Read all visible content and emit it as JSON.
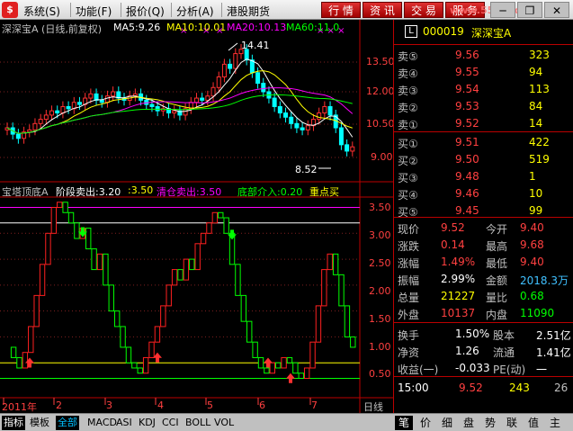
{
  "menubar": {
    "logo": "$",
    "items": [
      "系统(S)",
      "功能(F)",
      "报价(Q)",
      "分析(A)",
      "港股期货"
    ],
    "toolbar": [
      "行 情",
      "资 讯",
      "交 易",
      "服 务"
    ],
    "watermark": "www.55fx.com"
  },
  "kline": {
    "title": "深深宝A (日线,前复权)",
    "ma": [
      {
        "label": "MA5:9.26",
        "color": "#ffffff"
      },
      {
        "label": "MA10:10.01",
        "color": "#ffff00"
      },
      {
        "label": "MA20:10.13",
        "color": "#ff00ff"
      },
      {
        "label": "MA60:11.0",
        "color": "#00ff00"
      }
    ],
    "price_axis": [
      "13.50",
      "12.00",
      "10.50",
      "9.00"
    ],
    "high_mark": "14.41",
    "low_mark": "8.52"
  },
  "indicator": {
    "name": "宝塔顶底A",
    "lines": [
      {
        "text": "阶段卖出:3.20",
        "color": "#ffffff"
      },
      {
        "text": ":3.50",
        "color": "#ffff00"
      },
      {
        "text": "清仓卖出:3.50",
        "color": "#ff00ff"
      },
      {
        "text": "底部介入:0.20",
        "color": "#00ff00"
      },
      {
        "text": "重点买",
        "color": "#ffff00"
      }
    ],
    "axis": [
      "3.50",
      "3.00",
      "2.50",
      "2.00",
      "1.50",
      "1.00",
      "0.50"
    ]
  },
  "date_axis": [
    "2011年",
    "2",
    "3",
    "4",
    "5",
    "6",
    "7"
  ],
  "period_label": "日线",
  "bottom_tabs": [
    "指标",
    "模板",
    "全部",
    "MACD",
    "ASI",
    "KDJ",
    "CCI",
    "BOLL",
    "VOL"
  ],
  "right_tabs": [
    "笔",
    "价",
    "细",
    "盘",
    "势",
    "联",
    "值",
    "主"
  ],
  "quote": {
    "code": "000019",
    "name": "深深宝A",
    "sell": [
      {
        "label": "卖⑤",
        "price": "9.56",
        "vol": "323"
      },
      {
        "label": "卖④",
        "price": "9.55",
        "vol": "94"
      },
      {
        "label": "卖③",
        "price": "9.54",
        "vol": "113"
      },
      {
        "label": "卖②",
        "price": "9.53",
        "vol": "84"
      },
      {
        "label": "卖①",
        "price": "9.52",
        "vol": "14"
      }
    ],
    "buy": [
      {
        "label": "买①",
        "price": "9.51",
        "vol": "422"
      },
      {
        "label": "买②",
        "price": "9.50",
        "vol": "519"
      },
      {
        "label": "买③",
        "price": "9.48",
        "vol": "1"
      },
      {
        "label": "买④",
        "price": "9.46",
        "vol": "10"
      },
      {
        "label": "买⑤",
        "price": "9.45",
        "vol": "99"
      }
    ],
    "stats": [
      {
        "l1": "现价",
        "v1": "9.52",
        "c1": "#ff4040",
        "l2": "今开",
        "v2": "9.40",
        "c2": "#ff4040"
      },
      {
        "l1": "涨跌",
        "v1": "0.14",
        "c1": "#ff4040",
        "l2": "最高",
        "v2": "9.68",
        "c2": "#ff4040"
      },
      {
        "l1": "涨幅",
        "v1": "1.49%",
        "c1": "#ff4040",
        "l2": "最低",
        "v2": "9.40",
        "c2": "#ff4040"
      },
      {
        "l1": "振幅",
        "v1": "2.99%",
        "c1": "#ffffff",
        "l2": "金额",
        "v2": "2018.3万",
        "c2": "#40c0ff"
      },
      {
        "l1": "总量",
        "v1": "21227",
        "c1": "#ffff00",
        "l2": "量比",
        "v2": "0.68",
        "c2": "#00ff00"
      },
      {
        "l1": "外盘",
        "v1": "10137",
        "c1": "#ff4040",
        "l2": "内盘",
        "v2": "11090",
        "c2": "#00ff00"
      }
    ],
    "stats2": [
      {
        "l1": "换手",
        "v1": "1.50%",
        "l2": "股本",
        "v2": "2.51亿"
      },
      {
        "l1": "净资",
        "v1": "1.26",
        "l2": "流通",
        "v2": "1.41亿"
      },
      {
        "l1": "收益(一)",
        "v1": "-0.033",
        "l2": "PE(动)",
        "v2": "一"
      }
    ],
    "trade": {
      "time": "15:00",
      "price": "9.52",
      "vol": "243",
      "num": "26"
    }
  },
  "chart_data": [
    {
      "type": "candlestick",
      "title": "深深宝A (日线,前复权)",
      "x": [
        "2011-01",
        "2011-02",
        "2011-03",
        "2011-04",
        "2011-05",
        "2011-06",
        "2011-07"
      ],
      "ylim": [
        8.5,
        14.5
      ],
      "high": 14.41,
      "low": 8.52,
      "series": [
        {
          "name": "MA5",
          "last": 9.26
        },
        {
          "name": "MA10",
          "last": 10.01
        },
        {
          "name": "MA20",
          "last": 10.13
        },
        {
          "name": "MA60",
          "last": 11.0
        }
      ]
    },
    {
      "type": "line",
      "title": "宝塔顶底A",
      "ylim": [
        0,
        3.7
      ],
      "thresholds": {
        "阶段卖出": 3.2,
        "清仓卖出": 3.5,
        "底部介入": 0.2
      },
      "values": [
        0.8,
        0.6,
        0.4,
        0.7,
        1.2,
        1.8,
        2.4,
        3.0,
        3.5,
        3.6,
        3.4,
        3.2,
        2.9,
        3.1,
        2.7,
        2.3,
        2.6,
        2.0,
        1.5,
        1.2,
        0.8,
        0.5,
        0.4,
        0.3,
        0.6,
        0.9,
        1.2,
        1.6,
        2.0,
        2.3,
        2.1,
        2.5,
        2.3,
        2.8,
        3.0,
        3.2,
        3.4,
        3.3,
        3.0,
        2.4,
        1.8,
        1.3,
        0.9,
        0.6,
        0.4,
        0.3,
        0.5,
        0.4,
        0.6,
        0.5,
        0.3,
        0.2,
        0.4,
        0.9,
        1.6,
        2.3,
        2.6,
        2.2,
        1.6,
        1.0,
        0.8
      ]
    }
  ]
}
